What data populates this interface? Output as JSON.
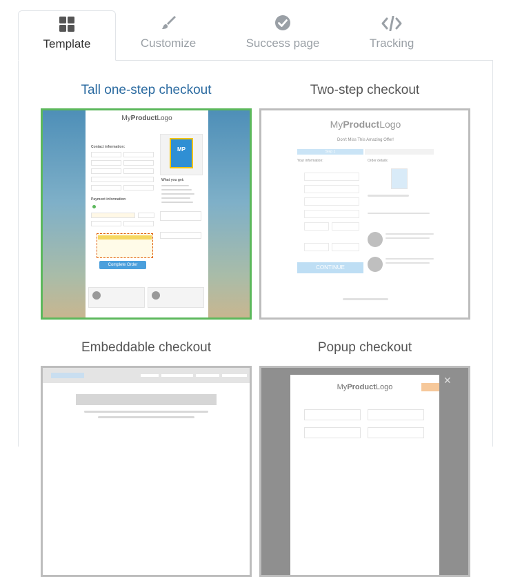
{
  "tabs": [
    {
      "label": "Template",
      "icon": "grid-icon",
      "active": true
    },
    {
      "label": "Customize",
      "icon": "brush-icon",
      "active": false
    },
    {
      "label": "Success page",
      "icon": "check-circle-icon",
      "active": false
    },
    {
      "label": "Tracking",
      "icon": "code-icon",
      "active": false
    }
  ],
  "templates": [
    {
      "title": "Tall one-step checkout",
      "selected": true
    },
    {
      "title": "Two-step checkout",
      "selected": false
    },
    {
      "title": "Embeddable checkout",
      "selected": false
    },
    {
      "title": "Popup checkout",
      "selected": false
    }
  ],
  "preview": {
    "logo_prefix": "My",
    "logo_bold": "Product",
    "logo_suffix": "Logo",
    "contact_heading": "Contact information:",
    "payment_heading": "Payment information:",
    "what_you_get": "What you get:",
    "complete_order": "Complete Order",
    "product_badge": "MP",
    "headline": "Don't Miss This Amazing Offer!",
    "your_information": "Your information:",
    "order_details": "Order details:",
    "step": "Step 1",
    "continue": "CONTINUE"
  },
  "colors": {
    "accent_blue": "#2a6aa0",
    "selected_border": "#5cb85c",
    "button_blue": "#4a9fdc"
  }
}
